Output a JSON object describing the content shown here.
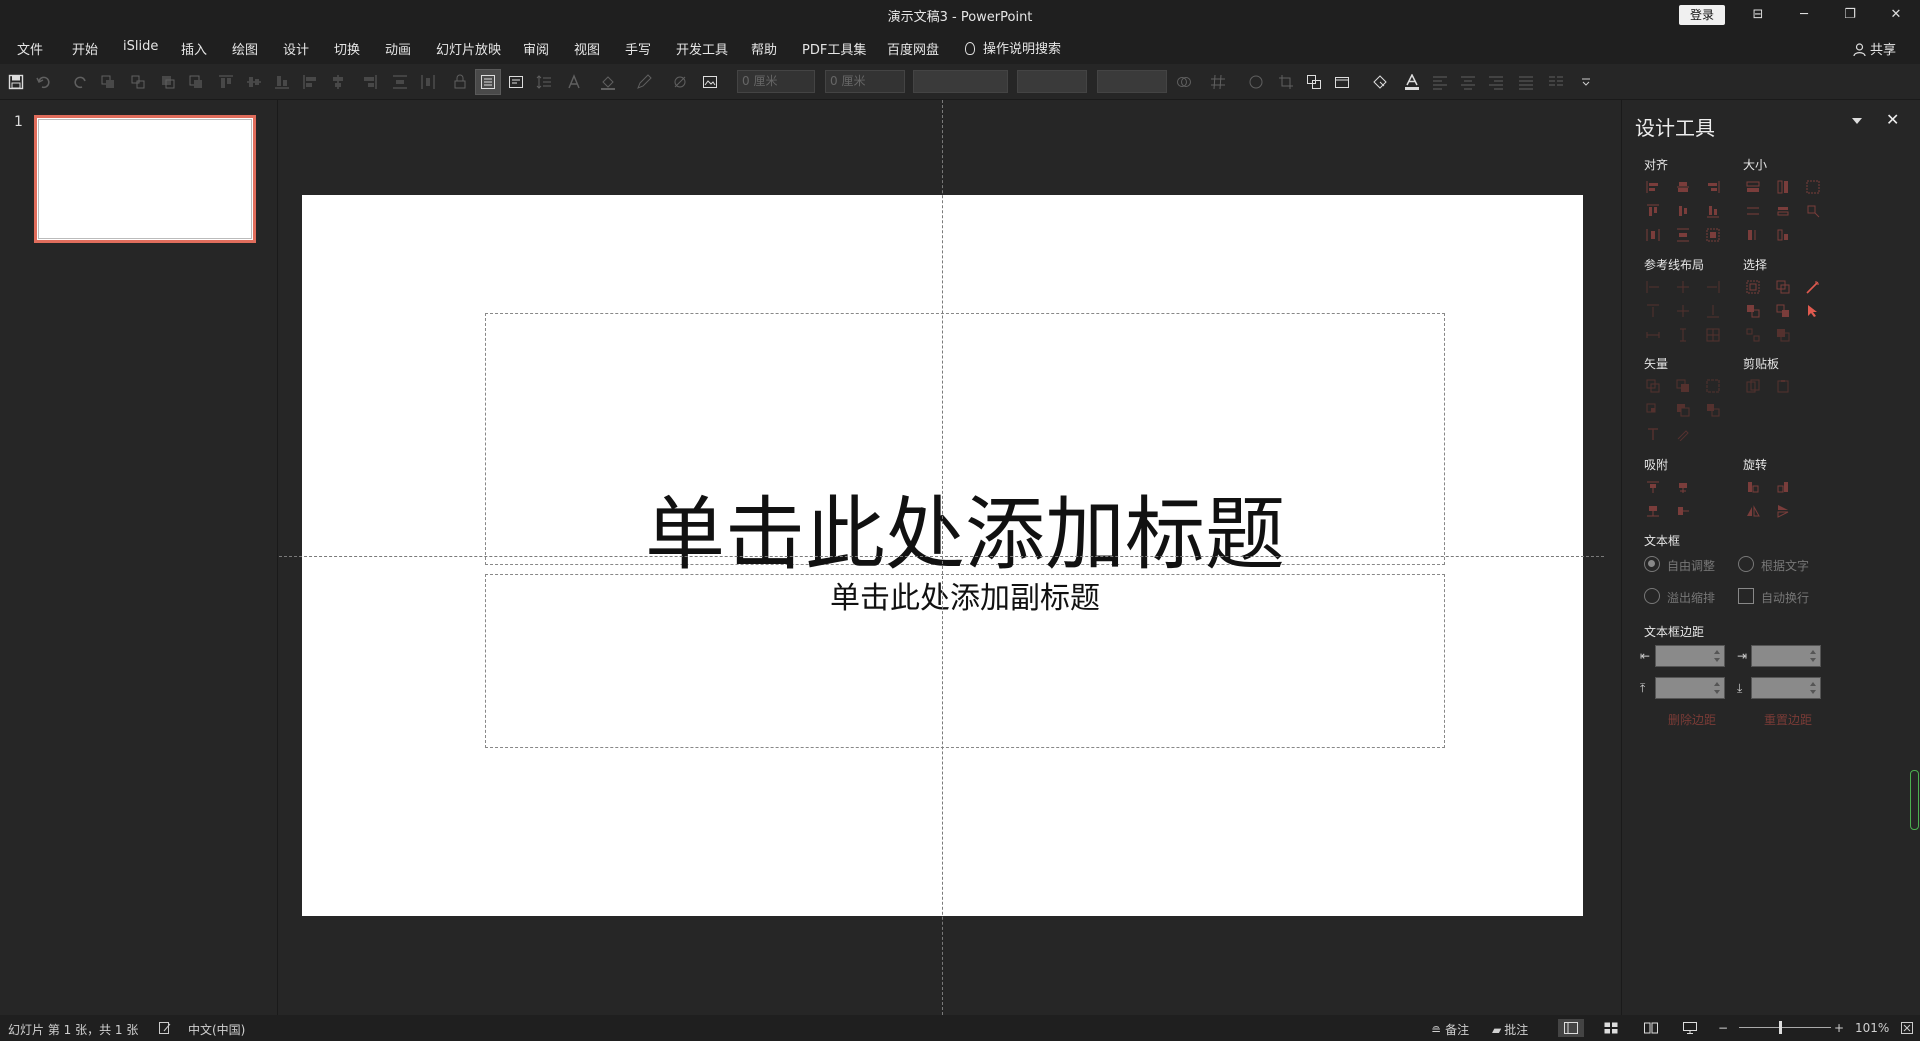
{
  "window": {
    "title": "演示文稿3  -  PowerPoint",
    "login_label": "登录",
    "controls": [
      "⊟",
      "─",
      "❐",
      "✕"
    ]
  },
  "menu": {
    "items": [
      "文件",
      "开始",
      "iSlide",
      "插入",
      "绘图",
      "设计",
      "切换",
      "动画",
      "幻灯片放映",
      "审阅",
      "视图",
      "手写",
      "开发工具",
      "帮助",
      "PDF工具集",
      "百度网盘"
    ],
    "tell_me": "操作说明搜索",
    "share": "共享"
  },
  "toolbar": {
    "width_field": "0 厘米",
    "height_field": "0 厘米"
  },
  "thumbnails": {
    "slide_number": "1"
  },
  "slide": {
    "title_placeholder": "单击此处添加标题",
    "subtitle_placeholder": "单击此处添加副标题"
  },
  "design_panel": {
    "title": "设计工具",
    "close": "✕",
    "sections": {
      "align": "对齐",
      "size": "大小",
      "guide_layout": "参考线布局",
      "select": "选择",
      "vector": "矢量",
      "clipboard": "剪贴板",
      "snap": "吸附",
      "rotate": "旋转",
      "textbox": "文本框",
      "textbox_margin": "文本框边距"
    },
    "textbox_options": {
      "auto_fit": "自由调整",
      "fit_text": "根据文字",
      "overflow_shrink": "溢出缩排",
      "auto_wrap": "自动换行"
    },
    "margin_actions": {
      "delete": "删除边距",
      "reset": "重置边距"
    }
  },
  "status": {
    "slide_info": "幻灯片 第 1 张，共 1 张",
    "language": "中文(中国)",
    "notes": "备注",
    "comments": "批注",
    "zoom_minus": "−",
    "zoom_plus": "+",
    "zoom": "101%"
  },
  "colors": {
    "accent_red": "#e06d5c",
    "bg": "#262626",
    "bar": "#1f1f1f"
  }
}
